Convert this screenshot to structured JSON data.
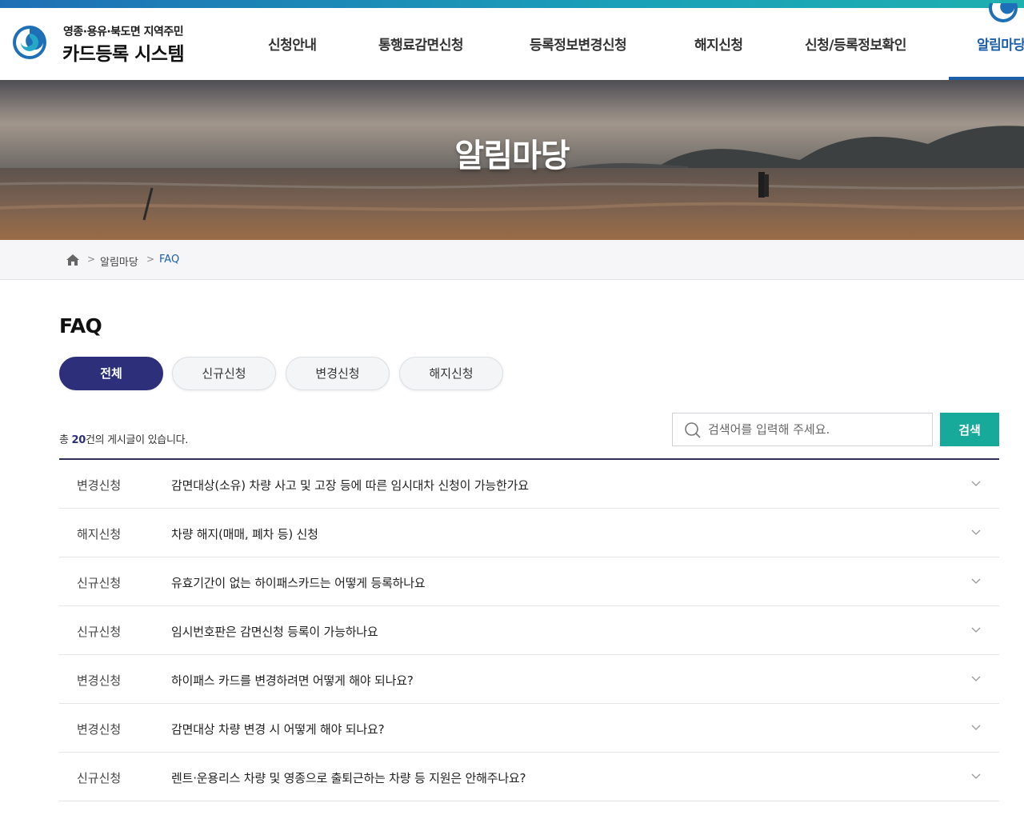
{
  "header": {
    "brand_sub": "영종·용유·북도면 지역주민",
    "brand_main": "카드등록 시스템",
    "nav": [
      {
        "label": "신청안내"
      },
      {
        "label": "통행료감면신청"
      },
      {
        "label": "등록정보변경신청"
      },
      {
        "label": "해지신청"
      },
      {
        "label": "신청/등록정보확인"
      },
      {
        "label": "알림마당"
      }
    ],
    "active_nav": "알림마당"
  },
  "hero": {
    "title": "알림마당"
  },
  "breadcrumb": {
    "home_icon": "home-icon",
    "items": [
      {
        "label": "알림마당"
      },
      {
        "label": "FAQ"
      }
    ]
  },
  "main": {
    "title": "FAQ",
    "tabs": [
      {
        "label": "전체",
        "active": true
      },
      {
        "label": "신규신청",
        "active": false
      },
      {
        "label": "변경신청",
        "active": false
      },
      {
        "label": "해지신청",
        "active": false
      }
    ],
    "count": {
      "prefix": "총 ",
      "number": "20",
      "suffix": "건의 게시글이 있습니다."
    },
    "search": {
      "placeholder": "검색어를 입력해 주세요.",
      "value": "",
      "button_label": "검색"
    },
    "faqs": [
      {
        "category": "변경신청",
        "question": "감면대상(소유) 차량 사고 및 고장 등에 따른 임시대차 신청이 가능한가요"
      },
      {
        "category": "해지신청",
        "question": "차량 해지(매매, 폐차 등) 신청"
      },
      {
        "category": "신규신청",
        "question": "유효기간이 없는 하이패스카드는 어떻게 등록하나요"
      },
      {
        "category": "신규신청",
        "question": "임시번호판은 감면신청 등록이 가능하나요"
      },
      {
        "category": "변경신청",
        "question": "하이패스 카드를 변경하려면 어떻게 해야 되나요?"
      },
      {
        "category": "변경신청",
        "question": "감면대상 차량 변경 시 어떻게 해야 되나요?"
      },
      {
        "category": "신규신청",
        "question": "렌트·운용리스 차량 및 영종으로 출퇴근하는 차량 등 지원은 안해주나요?"
      }
    ]
  },
  "colors": {
    "accent_navy": "#2d2f7a",
    "nav_active": "#1d5fa8",
    "search_button": "#17a99a",
    "top_bar": "#1aa0b8"
  }
}
